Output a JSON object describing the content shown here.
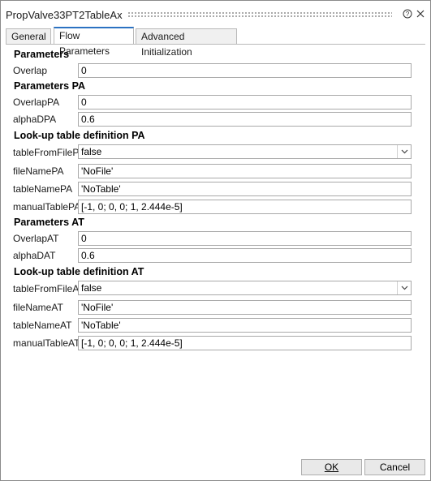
{
  "window": {
    "title": "PropValve33PT2TableAx"
  },
  "tabs": [
    {
      "label": "General"
    },
    {
      "label": "Flow Parameters"
    },
    {
      "label": "Advanced Initialization"
    }
  ],
  "sections": {
    "parameters": {
      "title": "Parameters",
      "overlap": {
        "label": "Overlap",
        "value": "0"
      }
    },
    "parameters_pa": {
      "title": "Parameters PA",
      "overlap": {
        "label": "OverlapPA",
        "value": "0"
      },
      "alpha": {
        "label": "alphaDPA",
        "value": "0.6"
      }
    },
    "lookup_pa": {
      "title": "Look-up table definition PA",
      "table_from_file": {
        "label": "tableFromFilePA",
        "value": "false"
      },
      "file_name": {
        "label": "fileNamePA",
        "value": "'NoFile'"
      },
      "table_name": {
        "label": "tableNamePA",
        "value": "'NoTable'"
      },
      "manual_table": {
        "label": "manualTablePA",
        "value": "[-1, 0; 0, 0; 1, 2.444e-5]"
      }
    },
    "parameters_at": {
      "title": "Parameters AT",
      "overlap": {
        "label": "OverlapAT",
        "value": "0"
      },
      "alpha": {
        "label": "alphaDAT",
        "value": "0.6"
      }
    },
    "lookup_at": {
      "title": "Look-up table definition AT",
      "table_from_file": {
        "label": "tableFromFileAT",
        "value": "false"
      },
      "file_name": {
        "label": "fileNameAT",
        "value": "'NoFile'"
      },
      "table_name": {
        "label": "tableNameAT",
        "value": "'NoTable'"
      },
      "manual_table": {
        "label": "manualTableAT",
        "value": "[-1, 0; 0, 0; 1, 2.444e-5]"
      }
    }
  },
  "buttons": {
    "ok": "OK",
    "cancel": "Cancel"
  },
  "icons": {
    "help": "help-icon",
    "close": "close-icon",
    "dropdown": "chevron-down-icon"
  }
}
